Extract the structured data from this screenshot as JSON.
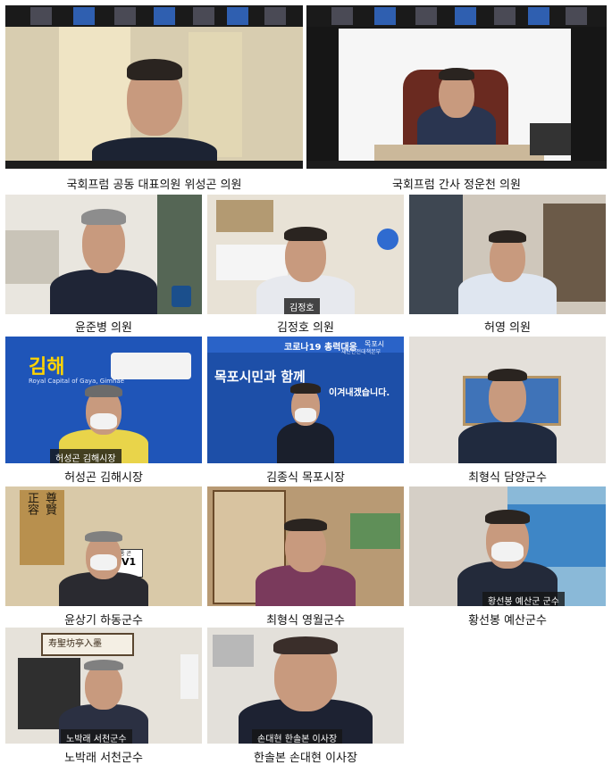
{
  "tiles": [
    {
      "caption": "국회프럼 공동 대표의원 위성곤 의원",
      "nametag": ""
    },
    {
      "caption": "국회프럼 간사 정운천 의원",
      "nametag": ""
    },
    {
      "caption": "윤준병 의원",
      "nametag": ""
    },
    {
      "caption": "김정호 의원",
      "nametag": "김정호"
    },
    {
      "caption": "허영 의원",
      "nametag": ""
    },
    {
      "caption": "허성곤 김해시장",
      "nametag": "허성곤 김해시장"
    },
    {
      "caption": "김종식 목포시장",
      "nametag": ""
    },
    {
      "caption": "최형식 담양군수",
      "nametag": ""
    },
    {
      "caption": "윤상기 하동군수",
      "nametag": ""
    },
    {
      "caption": "최형식 영월군수",
      "nametag": ""
    },
    {
      "caption": "황선봉 예산군수",
      "nametag": "황선봉 예산군 군수"
    },
    {
      "caption": "노박래 서천군수",
      "nametag": "노박래 서천군수"
    },
    {
      "caption": "한솔본 손대현 이사장",
      "nametag": "손대현 한솔본 이사장"
    }
  ],
  "signs": {
    "gimhae_logo": "김해",
    "gimhae_sub": "Royal Capital of Gaya, Gimhae",
    "mokpo_banner": "코로나19 총력대응",
    "mokpo_slogan": "목포시민과 함께",
    "mokpo_slogan2": "이겨내겠습니다.",
    "mokpo_city": "목포시",
    "mokpo_city_sub": "재난안전대책본부",
    "hadong_plate": "V1",
    "hadong_plate_top": "통 곤",
    "calligraphy_right": "尊賢",
    "calligraphy_left": "正容",
    "seocheon_frame": "寿聖坊亭入墨"
  }
}
